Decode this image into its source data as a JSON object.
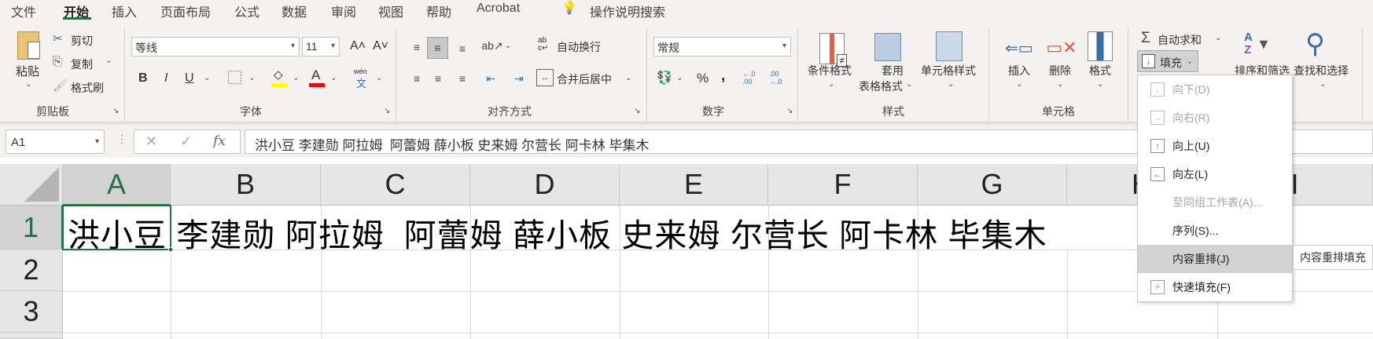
{
  "tabs": [
    "文件",
    "开始",
    "插入",
    "页面布局",
    "公式",
    "数据",
    "审阅",
    "视图",
    "帮助",
    "Acrobat"
  ],
  "active_tab": "开始",
  "tell_me": "操作说明搜索",
  "clipboard": {
    "paste": "粘贴",
    "cut": "剪切",
    "copy": "复制",
    "format_painter": "格式刷",
    "label": "剪贴板"
  },
  "font": {
    "name": "等线",
    "size": "11",
    "bold": "B",
    "italic": "I",
    "underline": "U",
    "phonetic": "wén",
    "label": "字体",
    "fill_color": "#ffff00",
    "font_color": "#ff0000"
  },
  "alignment": {
    "wrap_text": "自动换行",
    "merge_center": "合并后居中",
    "label": "对齐方式"
  },
  "number": {
    "format": "常规",
    "percent": "%",
    "comma": ",",
    "label": "数字"
  },
  "styles": {
    "conditional": "条件格式",
    "table_format_1": "套用",
    "table_format_2": "表格格式",
    "cell_styles": "单元格样式",
    "label": "样式"
  },
  "cells": {
    "insert": "插入",
    "delete": "删除",
    "format": "格式",
    "label": "单元格"
  },
  "editing": {
    "autosum": "自动求和",
    "fill": "填充",
    "sort_filter": "排序和筛选",
    "find_select": "查找和选择"
  },
  "formula_bar": {
    "name_box": "A1",
    "content": "洪小豆 李建勋 阿拉姆  阿蕾姆 薛小板 史来姆 尔营长 阿卡林 毕集木"
  },
  "grid": {
    "columns": [
      "A",
      "B",
      "C",
      "D",
      "E",
      "F",
      "G",
      "H",
      "I"
    ],
    "rows": [
      "1",
      "2",
      "3"
    ],
    "A1": "洪小豆 李建勋 阿拉姆  阿蕾姆 薛小板 史来姆 尔营长 阿卡林 毕集木"
  },
  "fill_menu": {
    "items": [
      {
        "label": "向下(D)",
        "icon": "fill-down-icon",
        "disabled": true
      },
      {
        "label": "向右(R)",
        "icon": "fill-right-icon",
        "disabled": true
      },
      {
        "label": "向上(U)",
        "icon": "fill-up-icon",
        "disabled": false
      },
      {
        "label": "向左(L)",
        "icon": "fill-left-icon",
        "disabled": false
      },
      {
        "label": "至同组工作表(A)...",
        "disabled": true
      },
      {
        "label": "序列(S)...",
        "disabled": false
      },
      {
        "label": "内容重排(J)",
        "disabled": false,
        "highlighted": true
      },
      {
        "label": "快速填充(F)",
        "icon": "flash-fill-icon",
        "disabled": false
      }
    ]
  },
  "tooltip": "内容重排填充",
  "accent": "#217346"
}
